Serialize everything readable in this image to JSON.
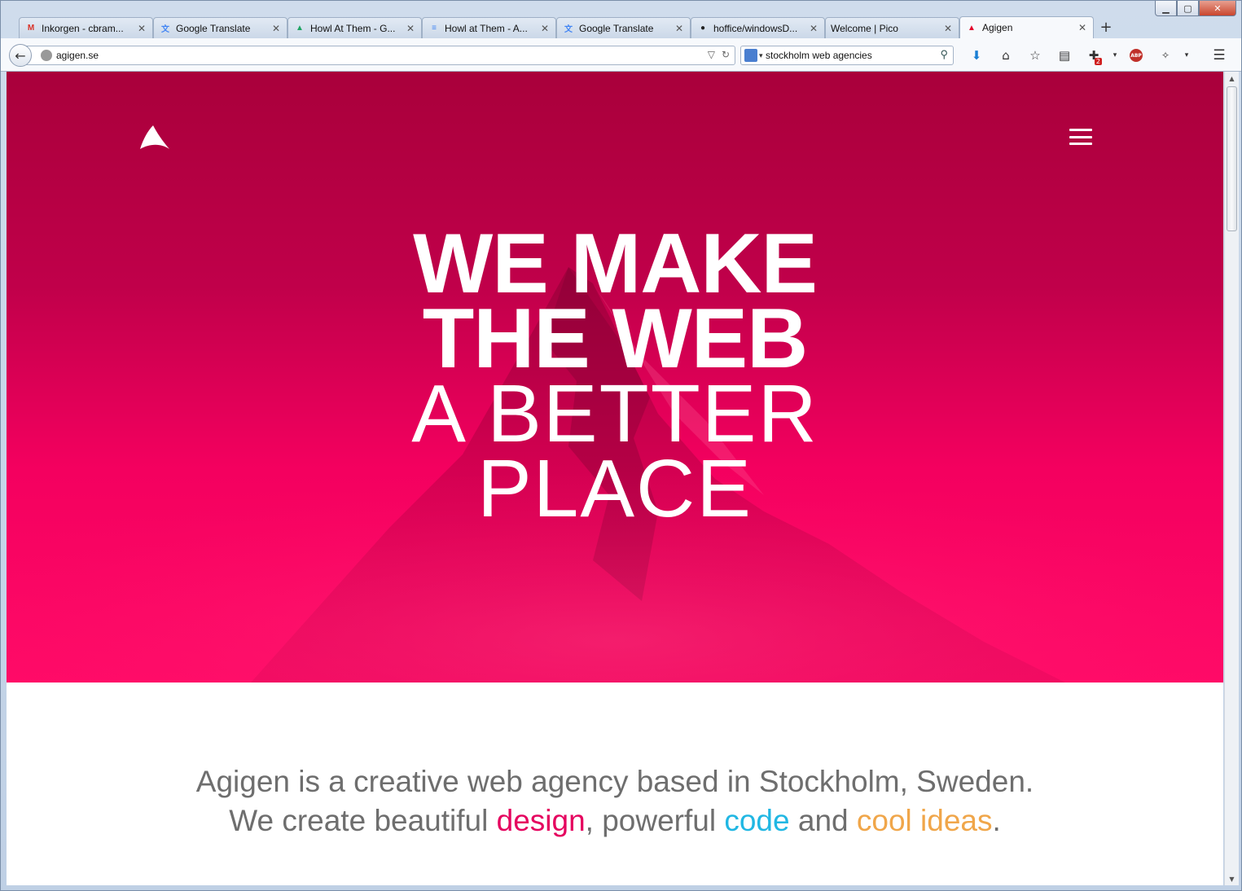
{
  "window": {
    "controls": {
      "minimize": "▁",
      "maximize": "▢",
      "close": "✕"
    }
  },
  "tabs": [
    {
      "label": "Inkorgen - cbram...",
      "icon": "gmail-icon",
      "icon_glyph": "M",
      "icon_color": "#d93025",
      "close": "✕"
    },
    {
      "label": "Google Translate",
      "icon": "translate-icon",
      "icon_glyph": "文",
      "icon_color": "#4285f4",
      "close": "✕"
    },
    {
      "label": "Howl At Them - G...",
      "icon": "drive-icon",
      "icon_glyph": "▲",
      "icon_color": "#1fa463",
      "close": "✕"
    },
    {
      "label": "Howl at Them - A...",
      "icon": "docs-icon",
      "icon_glyph": "≡",
      "icon_color": "#4285f4",
      "close": "✕"
    },
    {
      "label": "Google Translate",
      "icon": "translate-icon",
      "icon_glyph": "文",
      "icon_color": "#4285f4",
      "close": "✕"
    },
    {
      "label": "hoffice/windowsD...",
      "icon": "github-icon",
      "icon_glyph": "●",
      "icon_color": "#222222",
      "close": "✕"
    },
    {
      "label": "Welcome | Pico",
      "icon": "",
      "icon_glyph": "",
      "icon_color": "#222222",
      "close": "✕"
    },
    {
      "label": "Agigen",
      "icon": "agigen-icon",
      "icon_glyph": "▲",
      "icon_color": "#e3002b",
      "close": "✕",
      "active": true
    }
  ],
  "new_tab": "+",
  "navbar": {
    "back": "←",
    "url": "agigen.se",
    "url_dropdown": "▽",
    "reload": "↻",
    "search_value": "stockholm web agencies",
    "search_engine_arrow": "▾",
    "search_go": "⚲"
  },
  "toolbar": {
    "download": "⬇",
    "home": "⌂",
    "bookmark": "☆",
    "reading_list": "▤",
    "addon_badge": "2",
    "abp_label": "ABP",
    "menu": "☰"
  },
  "hero": {
    "line1": "WE MAKE",
    "line2": "THE WEB",
    "line3": "A BETTER",
    "line4": "PLACE"
  },
  "intro": {
    "line1": "Agigen is a creative web agency based in Stockholm, Sweden.",
    "line2_before": "We create beautiful ",
    "design": "design",
    "line2_mid1": ", powerful ",
    "code": "code",
    "line2_mid2": " and ",
    "ideas": "cool ideas",
    "line2_end": "."
  },
  "colors": {
    "brand_pink": "#e5045f",
    "code_blue": "#21b7e3",
    "ideas_orange": "#f0a64a",
    "text_gray": "#6e6e6e"
  },
  "scrollbar": {
    "up": "▲",
    "down": "▼"
  }
}
